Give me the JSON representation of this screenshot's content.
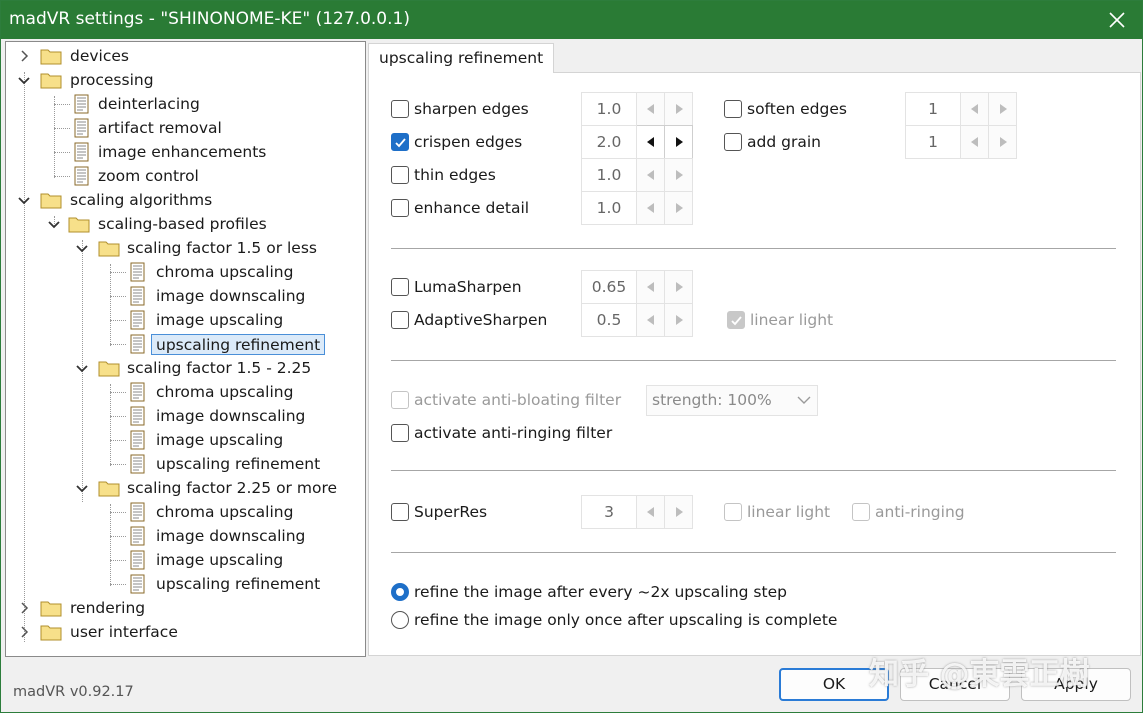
{
  "window": {
    "title": "madVR settings - \"SHINONOME-KE\" (127.0.0.1)",
    "close_icon": "close-icon"
  },
  "tree": {
    "items": [
      {
        "label": "devices"
      },
      {
        "label": "processing"
      },
      {
        "label": "deinterlacing"
      },
      {
        "label": "artifact removal"
      },
      {
        "label": "image enhancements"
      },
      {
        "label": "zoom control"
      },
      {
        "label": "scaling algorithms"
      },
      {
        "label": "scaling-based profiles"
      },
      {
        "label": "scaling factor 1.5 or less"
      },
      {
        "label": "chroma upscaling"
      },
      {
        "label": "image downscaling"
      },
      {
        "label": "image upscaling"
      },
      {
        "label": "upscaling refinement"
      },
      {
        "label": "scaling factor 1.5 - 2.25"
      },
      {
        "label": "chroma upscaling"
      },
      {
        "label": "image downscaling"
      },
      {
        "label": "image upscaling"
      },
      {
        "label": "upscaling refinement"
      },
      {
        "label": "scaling factor 2.25 or more"
      },
      {
        "label": "chroma upscaling"
      },
      {
        "label": "image downscaling"
      },
      {
        "label": "image upscaling"
      },
      {
        "label": "upscaling refinement"
      },
      {
        "label": "rendering"
      },
      {
        "label": "user interface"
      }
    ]
  },
  "version": "madVR v0.92.17",
  "tab": {
    "label": "upscaling refinement"
  },
  "options": {
    "sharpen_edges": {
      "label": "sharpen edges",
      "value": "1.0",
      "checked": false
    },
    "crispen_edges": {
      "label": "crispen edges",
      "value": "2.0",
      "checked": true
    },
    "thin_edges": {
      "label": "thin edges",
      "value": "1.0",
      "checked": false
    },
    "enhance_detail": {
      "label": "enhance detail",
      "value": "1.0",
      "checked": false
    },
    "soften_edges": {
      "label": "soften edges",
      "value": "1",
      "checked": false
    },
    "add_grain": {
      "label": "add grain",
      "value": "1",
      "checked": false
    },
    "luma_sharpen": {
      "label": "LumaSharpen",
      "value": "0.65",
      "checked": false
    },
    "adaptive_sharpen": {
      "label": "AdaptiveSharpen",
      "value": "0.5",
      "checked": false
    },
    "adaptive_linear_light": {
      "label": "linear light",
      "checked": true,
      "disabled": true
    },
    "anti_bloating": {
      "label": "activate anti-bloating filter",
      "checked": false,
      "disabled": true
    },
    "strength": {
      "value": "strength: 100%"
    },
    "anti_ringing": {
      "label": "activate anti-ringing filter",
      "checked": false
    },
    "superres": {
      "label": "SuperRes",
      "value": "3",
      "checked": false
    },
    "superres_linear_light": {
      "label": "linear light",
      "checked": false,
      "disabled": true
    },
    "superres_anti_ringing": {
      "label": "anti-ringing",
      "checked": false,
      "disabled": true
    }
  },
  "refine_mode": {
    "every_step": {
      "label": "refine the image after every ~2x upscaling step",
      "selected": true
    },
    "once": {
      "label": "refine the image only once after upscaling is complete",
      "selected": false
    }
  },
  "buttons": {
    "ok": "OK",
    "cancel": "Cancel",
    "apply": "Apply"
  },
  "watermark": "知乎 @東雲正樹",
  "colors": {
    "titlebar": "#2a7b35",
    "accent": "#1e6fc8",
    "folder": "#f7e08a"
  }
}
